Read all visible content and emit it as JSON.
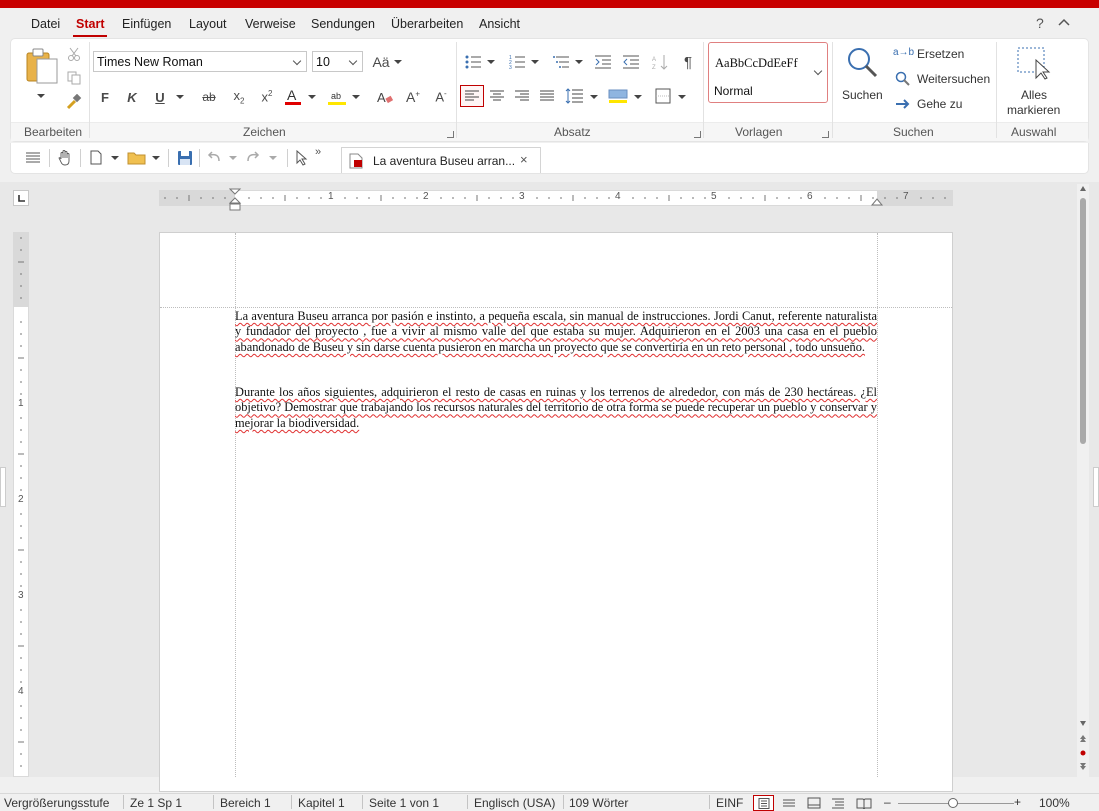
{
  "menu": {
    "items": [
      {
        "label": "Datei"
      },
      {
        "label": "Start"
      },
      {
        "label": "Einfügen"
      },
      {
        "label": "Layout"
      },
      {
        "label": "Verweise"
      },
      {
        "label": "Sendungen"
      },
      {
        "label": "Überarbeiten"
      },
      {
        "label": "Ansicht"
      }
    ],
    "active": "Start",
    "help_label": "?",
    "collapse_label": "^"
  },
  "ribbon": {
    "font_name": "Times New Roman",
    "font_size": "10",
    "styles_preview": "AaBbCcDdEeFf",
    "style_name": "Normal",
    "search_label": "Suchen",
    "replace_label": "Ersetzen",
    "find_next_label": "Weitersuchen",
    "goto_label": "Gehe zu",
    "select_all_label_1": "Alles",
    "select_all_label_2": "markieren",
    "bold_label": "F",
    "italic_label": "K",
    "underline_label": "U",
    "group_labels": {
      "edit": "Bearbeiten",
      "font": "Zeichen",
      "paragraph": "Absatz",
      "styles": "Vorlagen",
      "search": "Suchen",
      "select": "Auswahl"
    }
  },
  "toolbar": {
    "document_tab": "La aventura Buseu arran..."
  },
  "ruler": {
    "h_numbers": [
      "1",
      "2",
      "3",
      "4",
      "5",
      "6",
      "7"
    ],
    "v_numbers": [
      "1",
      "2",
      "3",
      "4"
    ]
  },
  "document": {
    "paragraphs": [
      "La aventura Buseu arranca por pasión e instinto, a pequeña escala, sin manual de instrucciones. Jordi Canut, referente naturalista y fundador del proyecto , fue a vivir al mismo valle del que estaba su mujer. Adquirieron en el 2003 una casa en el pueblo abandonado de Buseu y sin darse cuenta pusieron en marcha un proyecto que se convertiría en un reto personal , todo unsueño.",
      "Durante los años siguientes, adquirieron el resto de casas en ruinas y los terrenos de alrededor, con más de 230 hectáreas. ¿El objetivo? Demostrar que trabajando los recursos naturales del territorio de otra forma se puede recuperar un pueblo y conservar y mejorar la biodiversidad."
    ]
  },
  "status": {
    "zoom_label": "Vergrößerungsstufe",
    "position": "Ze 1 Sp 1",
    "section": "Bereich 1",
    "chapter": "Kapitel 1",
    "page": "Seite 1 von 1",
    "language": "Englisch (USA)",
    "words": "109 Wörter",
    "insert_mode": "EINF",
    "zoom_percent": "100%",
    "zoom_minus": "–",
    "zoom_plus": "+"
  },
  "colors": {
    "accent": "#c00000",
    "spell_underline": "#e03030",
    "font_color_bar": "#e00000",
    "highlight_bar": "#ffe600"
  }
}
